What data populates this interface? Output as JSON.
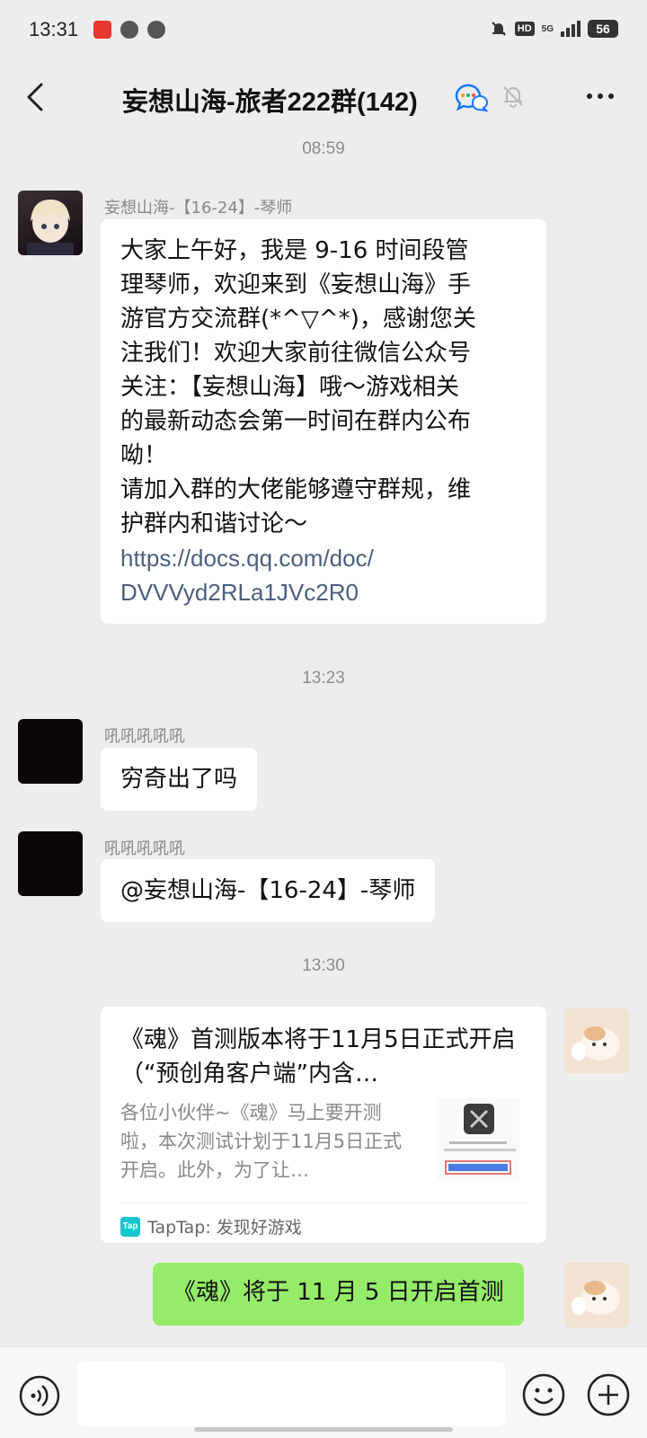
{
  "status_bar": {
    "time": "13:31",
    "network": "5G",
    "hd": "HD",
    "battery": "56"
  },
  "header": {
    "title": "妄想山海-旅者222群(142)"
  },
  "messages": [
    {
      "timestamp": "08:59"
    },
    {
      "sender": "妄想山海-【16-24】-琴师",
      "lines": [
        "大家上午好，我是 9-16 时间段管",
        "理琴师，欢迎来到《妄想山海》手",
        "游官方交流群(*^▽^*)，感谢您关",
        "注我们！欢迎大家前往微信公众号",
        "关注：【妄想山海】哦～游戏相关",
        "的最新动态会第一时间在群内公布",
        "呦！",
        "请加入群的大佬能够遵守群规，维",
        "护群内和谐讨论～"
      ],
      "link_lines": [
        "https://docs.qq.com/doc/",
        "DVVVyd2RLa1JVc2R0"
      ]
    },
    {
      "timestamp": "13:23"
    },
    {
      "sender": "吼吼吼吼吼",
      "text": "穷奇出了吗"
    },
    {
      "sender": "吼吼吼吼吼",
      "text": "@妄想山海-【16-24】-琴师"
    },
    {
      "timestamp": "13:30"
    },
    {
      "card": {
        "title": "《魂》首测版本将于11月5日正式开启（“预创角客户端”内含…",
        "description": "各位小伙伴~《魂》马上要开测啦，本次测试计划于11月5日正式开启。此外，为了让…",
        "source": "TapTap: 发现好游戏",
        "source_logo": "Tap"
      }
    },
    {
      "own_text": "《魂》将于 11 月 5 日开启首测"
    }
  ]
}
